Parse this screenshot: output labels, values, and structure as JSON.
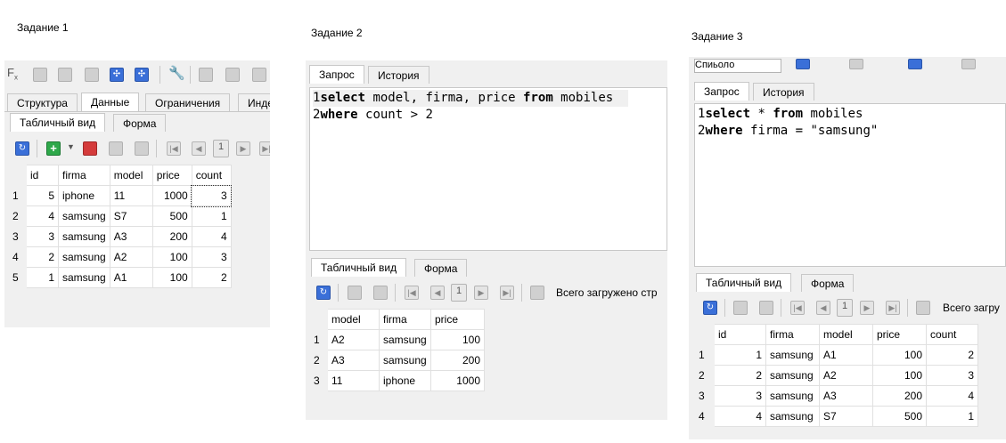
{
  "captions": {
    "task1": "Задание 1",
    "task2": "Задание 2",
    "task3": "Задание 3"
  },
  "panel1": {
    "tabs": [
      "Структура",
      "Данные",
      "Ограничения",
      "Инде"
    ],
    "subtabs": [
      "Табличный вид",
      "Форма"
    ],
    "page": "1",
    "columns": [
      "id",
      "firma",
      "model",
      "price",
      "count"
    ],
    "rows": [
      {
        "n": "1",
        "id": "5",
        "firma": "iphone",
        "model": "11",
        "price": "1000",
        "count": "3"
      },
      {
        "n": "2",
        "id": "4",
        "firma": "samsung",
        "model": "S7",
        "price": "500",
        "count": "1"
      },
      {
        "n": "3",
        "id": "3",
        "firma": "samsung",
        "model": "A3",
        "price": "200",
        "count": "4"
      },
      {
        "n": "4",
        "id": "2",
        "firma": "samsung",
        "model": "A2",
        "price": "100",
        "count": "3"
      },
      {
        "n": "5",
        "id": "1",
        "firma": "samsung",
        "model": "A1",
        "price": "100",
        "count": "2"
      }
    ]
  },
  "panel2": {
    "tabs": [
      "Запрос",
      "История"
    ],
    "sql": {
      "l1": {
        "no": "1",
        "kw1": "select",
        "t1": " model, firma, price ",
        "kw2": "from",
        "t2": " mobiles"
      },
      "l2": {
        "no": "2",
        "kw1": "where",
        "t1": " count > 2"
      }
    },
    "subtabs": [
      "Табличный вид",
      "Форма"
    ],
    "page": "1",
    "loaded_text": "Всего загружено стр",
    "columns": [
      "model",
      "firma",
      "price"
    ],
    "rows": [
      {
        "n": "1",
        "model": "A2",
        "firma": "samsung",
        "price": "100"
      },
      {
        "n": "2",
        "model": "A3",
        "firma": "samsung",
        "price": "200"
      },
      {
        "n": "3",
        "model": "11",
        "firma": "iphone",
        "price": "1000"
      }
    ]
  },
  "panel3": {
    "top_partial": "Спиьоло",
    "tabs": [
      "Запрос",
      "История"
    ],
    "sql": {
      "l1": {
        "no": "1",
        "kw1": "select",
        "t1": " * ",
        "kw2": "from",
        "t2": " mobiles"
      },
      "l2": {
        "no": "2",
        "kw1": "where",
        "t1": " firma = \"samsung\""
      }
    },
    "subtabs": [
      "Табличный вид",
      "Форма"
    ],
    "page": "1",
    "loaded_text": "Всего загру",
    "columns": [
      "id",
      "firma",
      "model",
      "price",
      "count"
    ],
    "rows": [
      {
        "n": "1",
        "id": "1",
        "firma": "samsung",
        "model": "A1",
        "price": "100",
        "count": "2"
      },
      {
        "n": "2",
        "id": "2",
        "firma": "samsung",
        "model": "A2",
        "price": "100",
        "count": "3"
      },
      {
        "n": "3",
        "id": "3",
        "firma": "samsung",
        "model": "A3",
        "price": "200",
        "count": "4"
      },
      {
        "n": "4",
        "id": "4",
        "firma": "samsung",
        "model": "S7",
        "price": "500",
        "count": "1"
      }
    ]
  }
}
